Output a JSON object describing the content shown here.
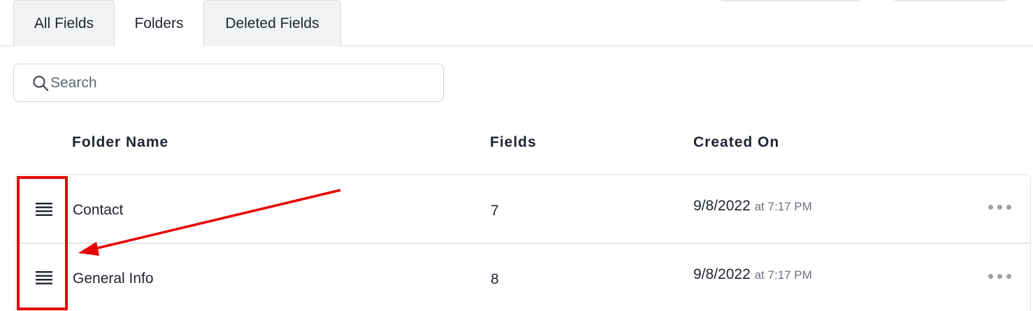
{
  "tabs": [
    {
      "label": "All Fields",
      "active": false
    },
    {
      "label": "Folders",
      "active": true
    },
    {
      "label": "Deleted Fields",
      "active": false
    }
  ],
  "search": {
    "placeholder": "Search",
    "value": ""
  },
  "table": {
    "headers": {
      "name": "Folder Name",
      "fields": "Fields",
      "created": "Created On"
    },
    "rows": [
      {
        "name": "Contact",
        "fields": "7",
        "date": "9/8/2022",
        "time": "at 7:17 PM"
      },
      {
        "name": "General Info",
        "fields": "8",
        "date": "9/8/2022",
        "time": "at 7:17 PM"
      }
    ]
  },
  "icons": {
    "search": "search-icon",
    "drag": "drag-handle-icon",
    "more": "more-horizontal-icon"
  },
  "colors": {
    "annotation": "#e60000",
    "tab_inactive_bg": "#f2f3f5",
    "border": "#dcdcdc",
    "muted_text": "#6b7280"
  }
}
